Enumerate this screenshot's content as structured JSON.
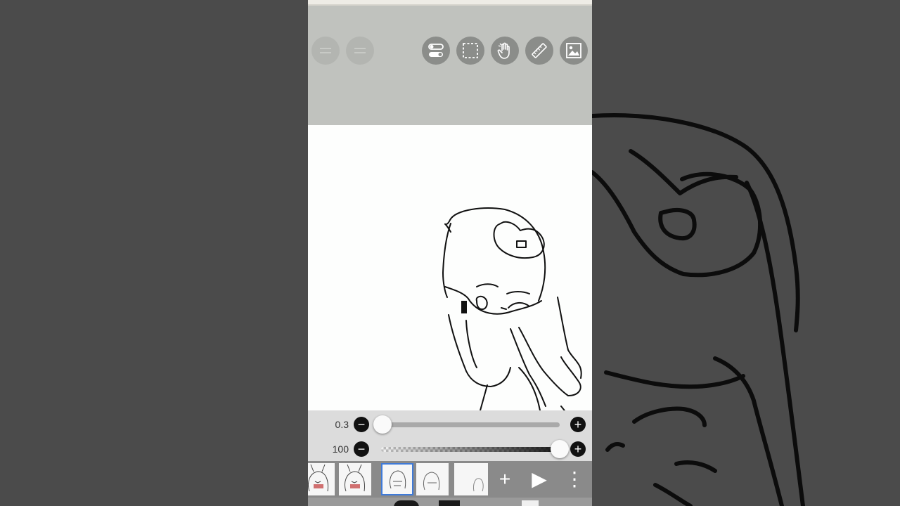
{
  "toolbar": {
    "left_buttons": [
      {
        "name": "undo-button",
        "icon": "undo-icon"
      },
      {
        "name": "redo-button",
        "icon": "redo-icon"
      }
    ],
    "right_buttons": [
      {
        "name": "toggle-settings-button",
        "icon": "toggle-switches-icon"
      },
      {
        "name": "selection-button",
        "icon": "dashed-selection-icon"
      },
      {
        "name": "hand-tool-button",
        "icon": "hand-icon"
      },
      {
        "name": "ruler-button",
        "icon": "ruler-icon"
      },
      {
        "name": "image-import-button",
        "icon": "image-icon"
      }
    ]
  },
  "brush": {
    "size_label": "0.3",
    "size_value": 0.0,
    "opacity_label": "100",
    "opacity_value": 1.0
  },
  "controls": {
    "minus_symbol": "−",
    "plus_symbol": "+"
  },
  "frames_bar": {
    "frame_count": 5,
    "selected_frame_index": 2,
    "add_frame_symbol": "+",
    "play_symbol": "▶",
    "more_symbol": "⋮"
  },
  "colors": {
    "toolbar_bg": "#c0c2be",
    "button_bg": "#8b8d8a",
    "selected_frame_border": "#3f7ad8",
    "canvas_bg": "#fdfefd"
  }
}
